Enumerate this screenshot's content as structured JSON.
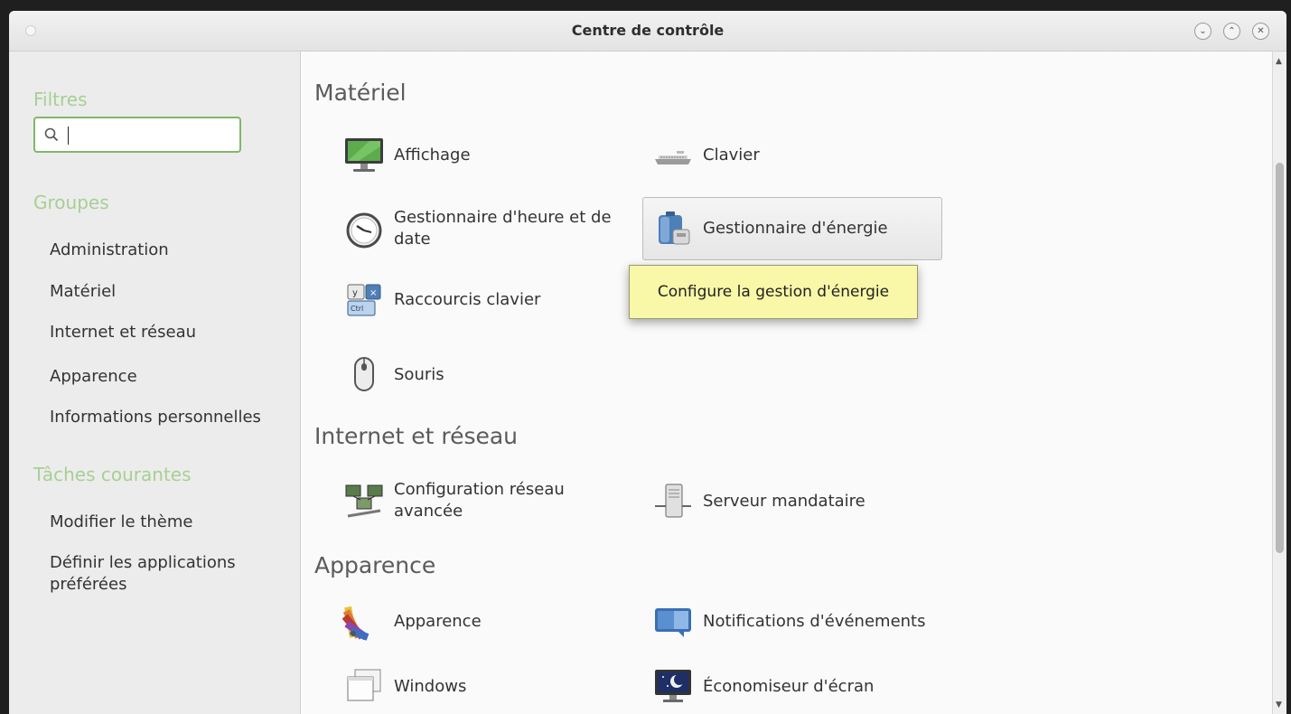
{
  "window": {
    "title": "Centre de contrôle",
    "buttons": {
      "minimize": "⌄",
      "maximize": "⌃",
      "close": "✕"
    }
  },
  "sidebar": {
    "filters_heading": "Filtres",
    "search": {
      "value": "",
      "placeholder": ""
    },
    "groups_heading": "Groupes",
    "groups": [
      {
        "label": "Administration"
      },
      {
        "label": "Matériel"
      },
      {
        "label": "Internet et réseau"
      },
      {
        "label": "Apparence"
      },
      {
        "label": "Informations personnelles"
      }
    ],
    "tasks_heading": "Tâches courantes",
    "tasks": [
      {
        "label": "Modifier le thème"
      },
      {
        "label": "Définir les applications préférées"
      }
    ]
  },
  "sections": {
    "hardware": {
      "title": "Matériel",
      "items": {
        "display": {
          "label": "Affichage",
          "icon": "monitor-icon"
        },
        "keyboard": {
          "label": "Clavier",
          "icon": "keyboard-icon"
        },
        "datetime": {
          "label": "Gestionnaire d'heure et de date",
          "icon": "clock-icon"
        },
        "power": {
          "label": "Gestionnaire d'énergie",
          "icon": "power-manager-icon"
        },
        "shortcuts": {
          "label": "Raccourcis clavier",
          "icon": "keyboard-shortcuts-icon"
        },
        "mouse": {
          "label": "Souris",
          "icon": "mouse-icon"
        }
      }
    },
    "network": {
      "title": "Internet et réseau",
      "items": {
        "advanced": {
          "label": "Configuration réseau avancée",
          "icon": "network-icon"
        },
        "proxy": {
          "label": "Serveur mandataire",
          "icon": "proxy-server-icon"
        }
      }
    },
    "appearance": {
      "title": "Apparence",
      "items": {
        "appearance": {
          "label": "Apparence",
          "icon": "palette-icon"
        },
        "notifications": {
          "label": "Notifications d'événements",
          "icon": "notification-icon"
        },
        "windows": {
          "label": "Windows",
          "icon": "windows-icon"
        },
        "screensaver": {
          "label": "Économiseur d'écran",
          "icon": "screensaver-icon"
        }
      }
    }
  },
  "tooltip": {
    "text": "Configure la gestion d'énergie"
  },
  "colors": {
    "accent": "#7fb86a",
    "heading_green": "#a7cf94",
    "tooltip_bg": "#f9f7a8"
  }
}
